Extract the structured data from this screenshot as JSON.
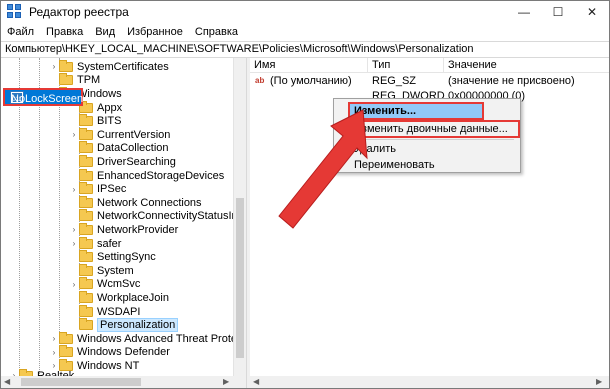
{
  "window": {
    "title": "Редактор реестра",
    "buttons": {
      "minimize": "—",
      "maximize": "☐",
      "close": "✕"
    }
  },
  "menu": [
    "Файл",
    "Правка",
    "Вид",
    "Избранное",
    "Справка"
  ],
  "address": "Компьютер\\HKEY_LOCAL_MACHINE\\SOFTWARE\\Policies\\Microsoft\\Windows\\Personalization",
  "tree": [
    {
      "label": "SystemCertificates",
      "level": 3,
      "expander": "›"
    },
    {
      "label": "TPM",
      "level": 3,
      "expander": ""
    },
    {
      "label": "Windows",
      "level": 3,
      "expander": "⌄"
    },
    {
      "label": "Appx",
      "level": 4,
      "expander": ""
    },
    {
      "label": "BITS",
      "level": 4,
      "expander": ""
    },
    {
      "label": "CurrentVersion",
      "level": 4,
      "expander": "›"
    },
    {
      "label": "DataCollection",
      "level": 4,
      "expander": ""
    },
    {
      "label": "DriverSearching",
      "level": 4,
      "expander": ""
    },
    {
      "label": "EnhancedStorageDevices",
      "level": 4,
      "expander": ""
    },
    {
      "label": "IPSec",
      "level": 4,
      "expander": "›"
    },
    {
      "label": "Network Connections",
      "level": 4,
      "expander": ""
    },
    {
      "label": "NetworkConnectivityStatusIndica",
      "level": 4,
      "expander": ""
    },
    {
      "label": "NetworkProvider",
      "level": 4,
      "expander": "›"
    },
    {
      "label": "safer",
      "level": 4,
      "expander": "›"
    },
    {
      "label": "SettingSync",
      "level": 4,
      "expander": ""
    },
    {
      "label": "System",
      "level": 4,
      "expander": ""
    },
    {
      "label": "WcmSvc",
      "level": 4,
      "expander": "›"
    },
    {
      "label": "WorkplaceJoin",
      "level": 4,
      "expander": ""
    },
    {
      "label": "WSDAPI",
      "level": 4,
      "expander": ""
    },
    {
      "label": "Personalization",
      "level": 4,
      "expander": "",
      "selected": true
    },
    {
      "label": "Windows Advanced Threat Protectio",
      "level": 3,
      "expander": "›"
    },
    {
      "label": "Windows Defender",
      "level": 3,
      "expander": "›"
    },
    {
      "label": "Windows NT",
      "level": 3,
      "expander": "›"
    },
    {
      "label": "Realtek",
      "level": 1,
      "expander": "›"
    }
  ],
  "list": {
    "columns": [
      "Имя",
      "Тип",
      "Значение"
    ],
    "rows": [
      {
        "name": "(По умолчанию)",
        "type": "REG_SZ",
        "value": "(значение не присвоено)",
        "icon": "ab"
      },
      {
        "name": "NoLockScreen",
        "type": "REG_DWORD",
        "value": "0x00000000 (0)",
        "icon": "binary",
        "selected": true
      }
    ]
  },
  "context_menu": [
    "Изменить...",
    "Изменить двоичные данные...",
    "Удалить",
    "Переименовать"
  ],
  "colors": {
    "highlight": "#0078d7",
    "annotation": "#e53935",
    "menu_highlight": "#91c9f7",
    "folder": "#f5c850"
  }
}
